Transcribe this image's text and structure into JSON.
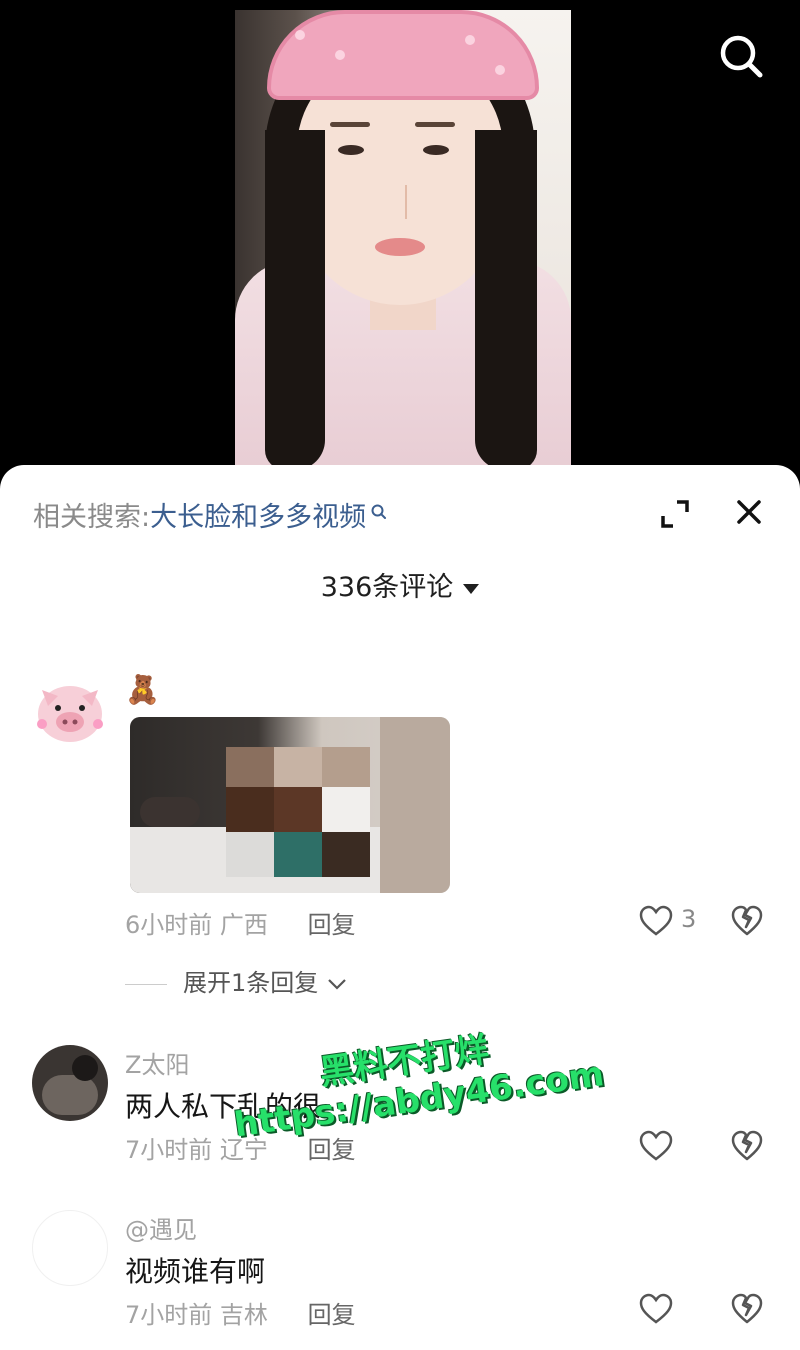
{
  "related_search": {
    "prefix": "相关搜索:",
    "query": "大长脸和多多视频"
  },
  "comments_count": "336条评论",
  "comments": [
    {
      "name": "",
      "emoji": "🧸",
      "has_image": true,
      "time": "6小时前",
      "location": "广西",
      "reply_label": "回复",
      "likes": "3"
    },
    {
      "name": "Z太阳",
      "text": "两人私下乱的很",
      "time": "7小时前",
      "location": "辽宁",
      "reply_label": "回复",
      "likes": ""
    },
    {
      "name": "@遇见",
      "text": "视频谁有啊",
      "time": "7小时前",
      "location": "吉林",
      "reply_label": "回复",
      "likes": ""
    }
  ],
  "expand_replies": "展开1条回复",
  "watermark": {
    "line1": "黑料不打烊",
    "line2": "https://abdy46.com"
  },
  "colors": {
    "query": "#3b5e8f",
    "watermark": "#27e06a"
  }
}
